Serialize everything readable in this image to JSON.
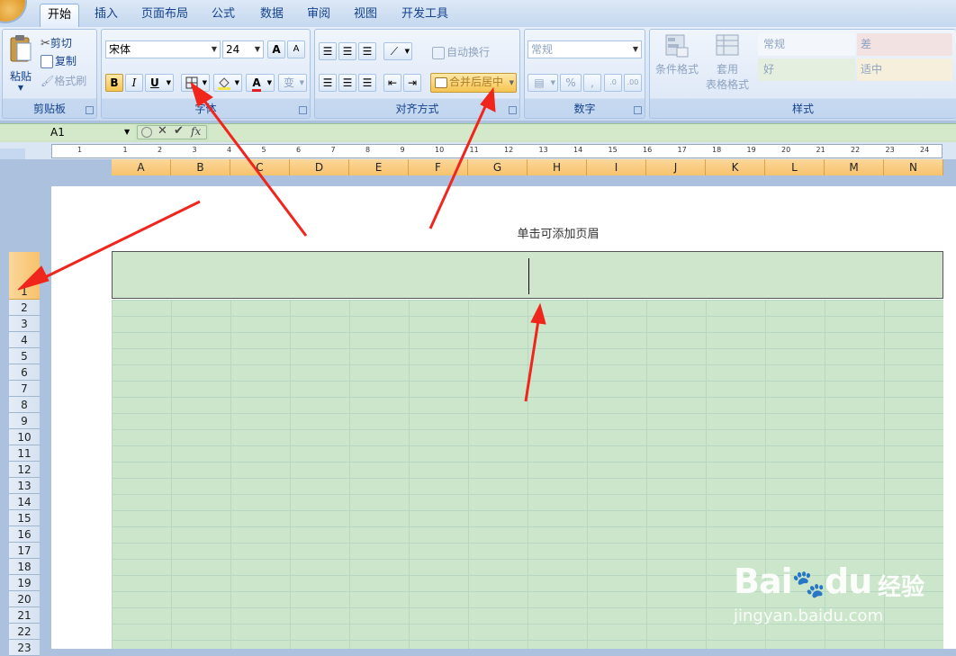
{
  "tabs": [
    "开始",
    "插入",
    "页面布局",
    "公式",
    "数据",
    "审阅",
    "视图",
    "开发工具"
  ],
  "clipboard": {
    "paste": "粘贴",
    "cut": "剪切",
    "copy": "复制",
    "format_painter": "格式刷",
    "label": "剪贴板"
  },
  "font": {
    "name": "宋体",
    "size": "24",
    "bold": "B",
    "italic": "I",
    "underline": "U",
    "label": "字体",
    "grow": "A",
    "shrink": "A",
    "font_color": "A",
    "wen": "变"
  },
  "alignment": {
    "wrap": "自动换行",
    "merge": "合并后居中",
    "label": "对齐方式"
  },
  "number": {
    "format": "常规",
    "percent": "%",
    "comma": ",",
    "label": "数字"
  },
  "styles": {
    "cond_format": "条件格式",
    "table_line1": "套用",
    "table_line2": "表格格式",
    "normal": "常规",
    "bad": "差",
    "good": "好",
    "neutral": "适中",
    "label": "样式"
  },
  "formula_bar": {
    "name_box": "A1",
    "fx": "fx"
  },
  "ruler_numbers": [
    "1",
    "1",
    "2",
    "3",
    "4",
    "5",
    "6",
    "7",
    "8",
    "9",
    "10",
    "11",
    "12",
    "13",
    "14",
    "15",
    "16",
    "17",
    "18",
    "19",
    "20",
    "21",
    "22",
    "23",
    "24"
  ],
  "columns": [
    "A",
    "B",
    "C",
    "D",
    "E",
    "F",
    "G",
    "H",
    "I",
    "J",
    "K",
    "L",
    "M",
    "N"
  ],
  "rows": [
    "1",
    "2",
    "3",
    "4",
    "5",
    "6",
    "7",
    "8",
    "9",
    "10",
    "11",
    "12",
    "13",
    "14",
    "15",
    "16",
    "17",
    "18",
    "19",
    "20",
    "21",
    "22",
    "23"
  ],
  "page": {
    "header_hint": "单击可添加页眉"
  },
  "watermark": {
    "brand": "Bai",
    "brand2": "du",
    "cn": "经验",
    "url": "jingyan.baidu.com"
  },
  "colors": {
    "annotation_arrow": "#f0261c",
    "selected_header": "#f7c26c",
    "grid_fill": "#cbe6cb"
  }
}
